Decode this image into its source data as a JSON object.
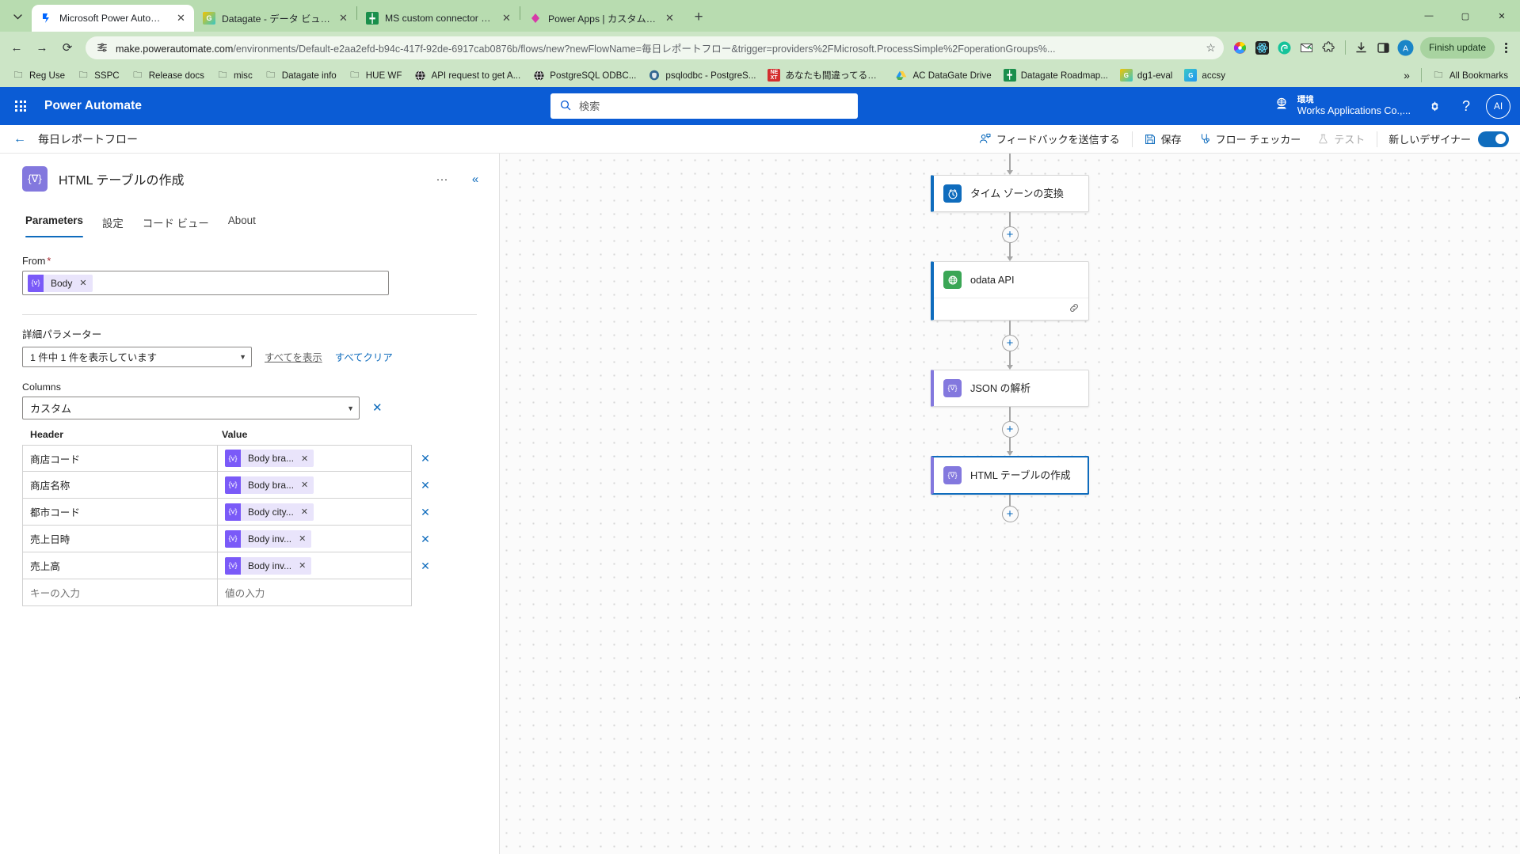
{
  "browser": {
    "tabs": [
      {
        "title": "Microsoft Power Automate",
        "favicon": "power-automate-icon",
        "active": true
      },
      {
        "title": "Datagate - データ ビューアー",
        "favicon": "datagate-icon",
        "active": false
      },
      {
        "title": "MS custom connector demo m",
        "favicon": "sharepoint-icon",
        "active": false
      },
      {
        "title": "Power Apps | カスタム コネクタ",
        "favicon": "power-apps-icon",
        "active": false
      }
    ],
    "new_tab_label": "+",
    "window_controls": {
      "minimize": "—",
      "maximize": "▢",
      "close": "✕"
    },
    "nav": {
      "back": "←",
      "forward": "→",
      "reload": "⟳"
    },
    "address": {
      "host": "make.powerautomate.com",
      "path": "/environments/Default-e2aa2efd-b94c-417f-92de-6917cab0876b/flows/new?newFlowName=毎日レポートフロー&trigger=providers%2FMicrosoft.ProcessSimple%2FoperationGroups%...",
      "star": "☆"
    },
    "toolbar_right": {
      "finish_update": "Finish update"
    },
    "bookmarks": [
      {
        "label": "Reg Use",
        "icon": "folder-icon"
      },
      {
        "label": "SSPC",
        "icon": "folder-icon"
      },
      {
        "label": "Release docs",
        "icon": "folder-icon"
      },
      {
        "label": "misc",
        "icon": "folder-icon"
      },
      {
        "label": "Datagate info",
        "icon": "folder-icon"
      },
      {
        "label": "HUE WF",
        "icon": "folder-icon"
      },
      {
        "label": "API request to get A...",
        "icon": "globe-icon"
      },
      {
        "label": "PostgreSQL ODBC...",
        "icon": "globe-icon"
      },
      {
        "label": "psqlodbc - PostgreS...",
        "icon": "postgres-icon"
      },
      {
        "label": "あなたも間違ってるかも...",
        "icon": "next-icon"
      },
      {
        "label": "AC DataGate Drive",
        "icon": "drive-icon"
      },
      {
        "label": "Datagate Roadmap...",
        "icon": "sharepoint-icon"
      },
      {
        "label": "dg1-eval",
        "icon": "datagate-icon"
      },
      {
        "label": "accsy",
        "icon": "datagate-icon"
      }
    ],
    "bookmarks_overflow": "»",
    "all_bookmarks": "All Bookmarks"
  },
  "app_header": {
    "waffle": "app-launcher-icon",
    "brand": "Power Automate",
    "search_placeholder": "検索",
    "search_value": "",
    "environment_label": "環境",
    "environment_name": "Works Applications Co.,...",
    "settings_icon": "gear-icon",
    "help_icon": "help-icon",
    "avatar_initials": "AI"
  },
  "command_bar": {
    "back": "←",
    "flow_name": "毎日レポートフロー",
    "buttons": [
      {
        "label": "フィードバックを送信する",
        "icon": "feedback-icon",
        "disabled": false
      },
      {
        "label": "保存",
        "icon": "save-icon",
        "disabled": false
      },
      {
        "label": "フロー チェッカー",
        "icon": "flow-checker-icon",
        "disabled": false
      },
      {
        "label": "テスト",
        "icon": "test-flask-icon",
        "disabled": true
      }
    ],
    "designer_toggle_label": "新しいデザイナー",
    "designer_toggle_on": true
  },
  "panel": {
    "icon": "expression-icon",
    "title": "HTML テーブルの作成",
    "more_icon": "ellipsis-icon",
    "collapse_icon": "collapse-chevrons-icon",
    "tabs": [
      {
        "label": "Parameters",
        "selected": true
      },
      {
        "label": "設定",
        "selected": false
      },
      {
        "label": "コード ビュー",
        "selected": false
      },
      {
        "label": "About",
        "selected": false
      }
    ],
    "from": {
      "label": "From",
      "required": "*",
      "token_badge": "{v}",
      "token_text": "Body",
      "token_remove": "✕"
    },
    "advanced": {
      "section_label": "詳細パラメーター",
      "select_value": "1 件中 1 件を表示しています",
      "show_all": "すべてを表示",
      "clear_all": "すべてクリア"
    },
    "columns": {
      "label": "Columns",
      "value": "カスタム",
      "remove": "✕"
    },
    "kv_table": {
      "headers": {
        "key": "Header",
        "value": "Value"
      },
      "rows": [
        {
          "key": "商店コード",
          "value_token": "Body bra...",
          "badge": "{v}",
          "remove": "✕"
        },
        {
          "key": "商店名称",
          "value_token": "Body bra...",
          "badge": "{v}",
          "remove": "✕"
        },
        {
          "key": "都市コード",
          "value_token": "Body city...",
          "badge": "{v}",
          "remove": "✕"
        },
        {
          "key": "売上日時",
          "value_token": "Body inv...",
          "badge": "{v}",
          "remove": "✕"
        },
        {
          "key": "売上高",
          "value_token": "Body inv...",
          "badge": "{v}",
          "remove": "✕"
        }
      ],
      "new_row": {
        "key_placeholder": "キーの入力",
        "value_placeholder": "値の入力"
      }
    }
  },
  "canvas": {
    "nodes": [
      {
        "title": "タイム ゾーンの変換",
        "icon": "clock-icon",
        "icon_color": "#0f6cbd",
        "accent": "#0f6cbd",
        "selected": false,
        "has_footer": false
      },
      {
        "title": "odata API",
        "icon": "globe-icon",
        "icon_color": "#3aa655",
        "accent": "#0f6cbd",
        "selected": false,
        "has_footer": true,
        "footer_icon": "link-icon"
      },
      {
        "title": "JSON の解析",
        "icon": "expression-icon",
        "icon_color": "#8378de",
        "accent": "#8378de",
        "selected": false,
        "has_footer": false
      },
      {
        "title": "HTML テーブルの作成",
        "icon": "expression-icon",
        "icon_color": "#8378de",
        "accent": "#8378de",
        "selected": true,
        "has_footer": false
      }
    ],
    "add_button": "+"
  },
  "colors": {
    "brand_blue": "#0b5cd5",
    "accent_blue": "#0f6cbd",
    "purple": "#8378de",
    "green": "#3aa655",
    "chrome_green": "#cce5c6"
  }
}
